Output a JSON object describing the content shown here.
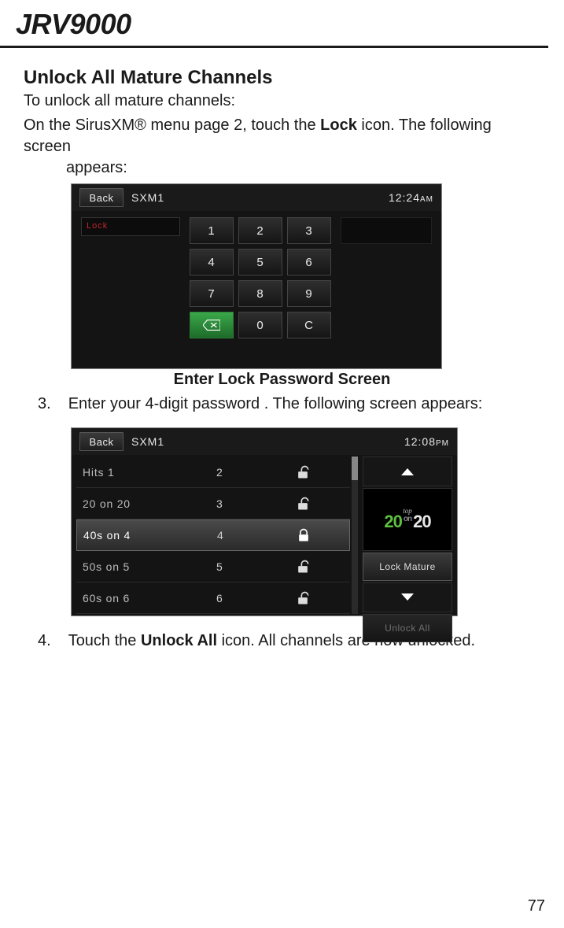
{
  "page": {
    "title": "JRV9000",
    "number": "77"
  },
  "section": {
    "heading": "Unlock All Mature Channels",
    "intro": "To unlock all mature channels:",
    "step_main_a": "On the SirusXM® menu page 2, touch the ",
    "step_main_bold": "Lock",
    "step_main_b": " icon. The following screen",
    "step_main_c": "appears:",
    "caption1": "Enter Lock Password Screen",
    "step3_num": "3.",
    "step3_text": "Enter your 4-digit password . The following screen appears:",
    "step4_num": "4.",
    "step4_a": "Touch the ",
    "step4_bold": "Unlock All",
    "step4_b": " icon. All channels are now unlocked."
  },
  "shot1": {
    "back": "Back",
    "source": "SXM1",
    "clock": "12:24",
    "ampm": "AM",
    "pw_label": "Lock",
    "keys": [
      "1",
      "2",
      "3",
      "4",
      "5",
      "6",
      "7",
      "8",
      "9",
      "",
      "0",
      "C"
    ]
  },
  "shot2": {
    "back": "Back",
    "source": "SXM1",
    "clock": "12:08",
    "ampm": "PM",
    "rows": [
      {
        "name": "Hits 1",
        "num": "2",
        "locked": false
      },
      {
        "name": "20 on 20",
        "num": "3",
        "locked": false
      },
      {
        "name": "40s on 4",
        "num": "4",
        "locked": true,
        "selected": true
      },
      {
        "name": "50s on 5",
        "num": "5",
        "locked": false
      },
      {
        "name": "60s on 6",
        "num": "6",
        "locked": false
      }
    ],
    "logo_top": "top",
    "logo_left": "20",
    "logo_sep": "on",
    "logo_right": "20",
    "lock_mature": "Lock Mature",
    "unlock_all": "Unlock All"
  }
}
